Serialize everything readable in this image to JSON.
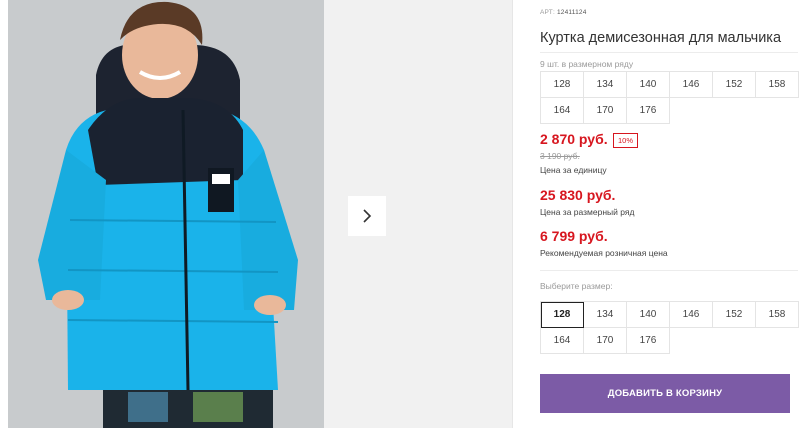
{
  "gallery": {
    "next_icon": "chevron-right-icon"
  },
  "product": {
    "art_label": "АРТ:",
    "art_value": "12411124",
    "title": "Куртка демисезонная для мальчика",
    "size_run_label": "9 шт. в размерном ряду",
    "size_run": [
      "128",
      "134",
      "140",
      "146",
      "152",
      "158",
      "164",
      "170",
      "176"
    ],
    "price": "2 870 руб.",
    "discount": "10%",
    "old_price": "3 190 руб.",
    "price_caption": "Цена за единицу",
    "set_price": "25 830 руб.",
    "set_caption": "Цена за размерный ряд",
    "retail_price": "6 799 руб.",
    "retail_caption": "Рекомендуемая розничная цена",
    "choose_size_label": "Выберите размер:",
    "sizes": [
      "128",
      "134",
      "140",
      "146",
      "152",
      "158",
      "164",
      "170",
      "176"
    ],
    "selected_size": "128",
    "add_to_cart": "ДОБАВИТЬ В КОРЗИНУ"
  },
  "colors": {
    "accent_price": "#d7161f",
    "button": "#7c5ba6",
    "jacket": "#1ab3ea"
  }
}
